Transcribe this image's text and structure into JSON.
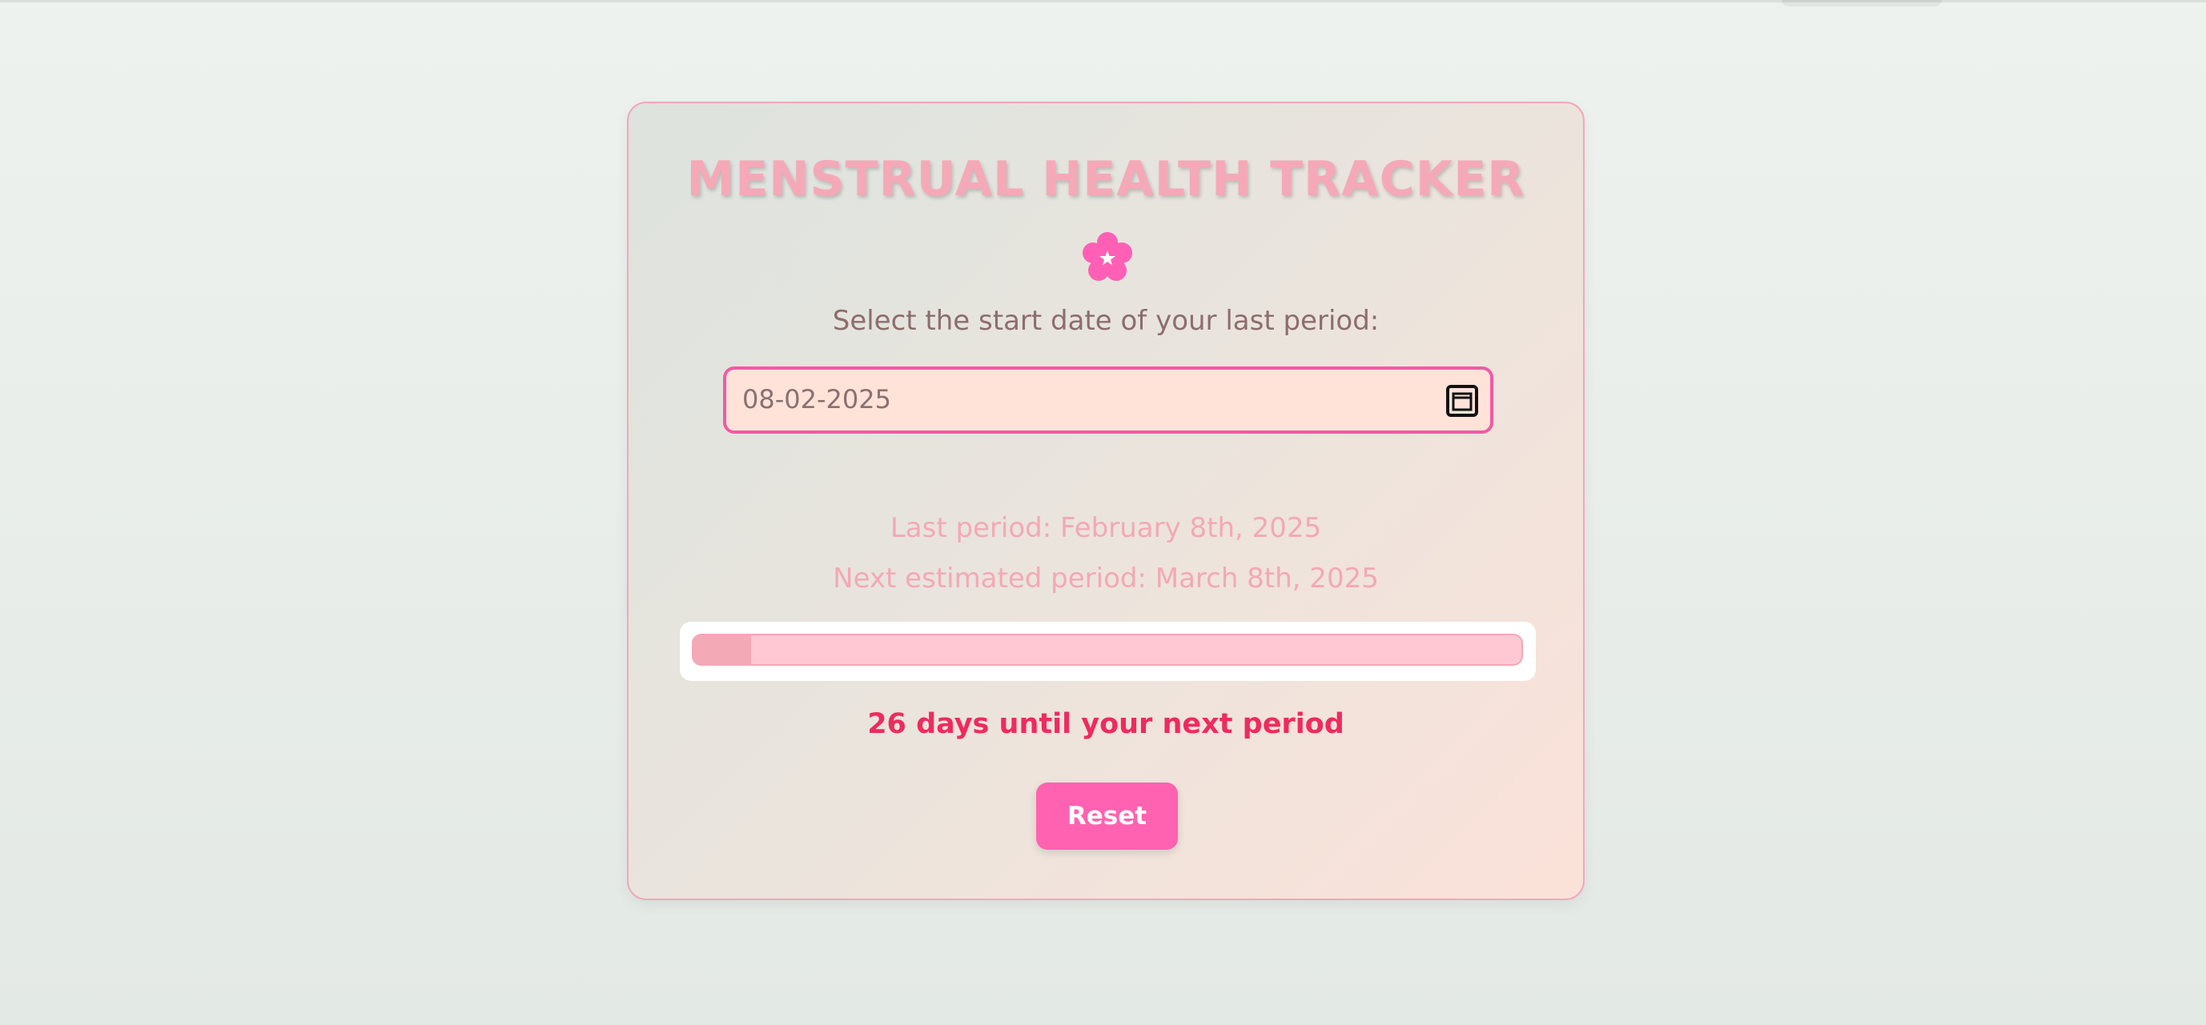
{
  "app": {
    "title": "MENSTRUAL HEALTH TRACKER",
    "flower_icon": "cherry-blossom-icon"
  },
  "form": {
    "prompt": "Select the start date of your last period:",
    "date_value": "08-02-2025",
    "calendar_icon": "calendar-icon"
  },
  "results": {
    "last_period": "Last period: February 8th, 2025",
    "next_period": "Next estimated period: March 8th, 2025",
    "progress_fraction": 0.07,
    "countdown": "26 days until your next period"
  },
  "actions": {
    "reset_label": "Reset"
  },
  "colors": {
    "accent": "#ff62b0",
    "title_pink": "#f5a9b8",
    "countdown_red": "#ee2b5e",
    "input_border": "#f15aa3"
  }
}
